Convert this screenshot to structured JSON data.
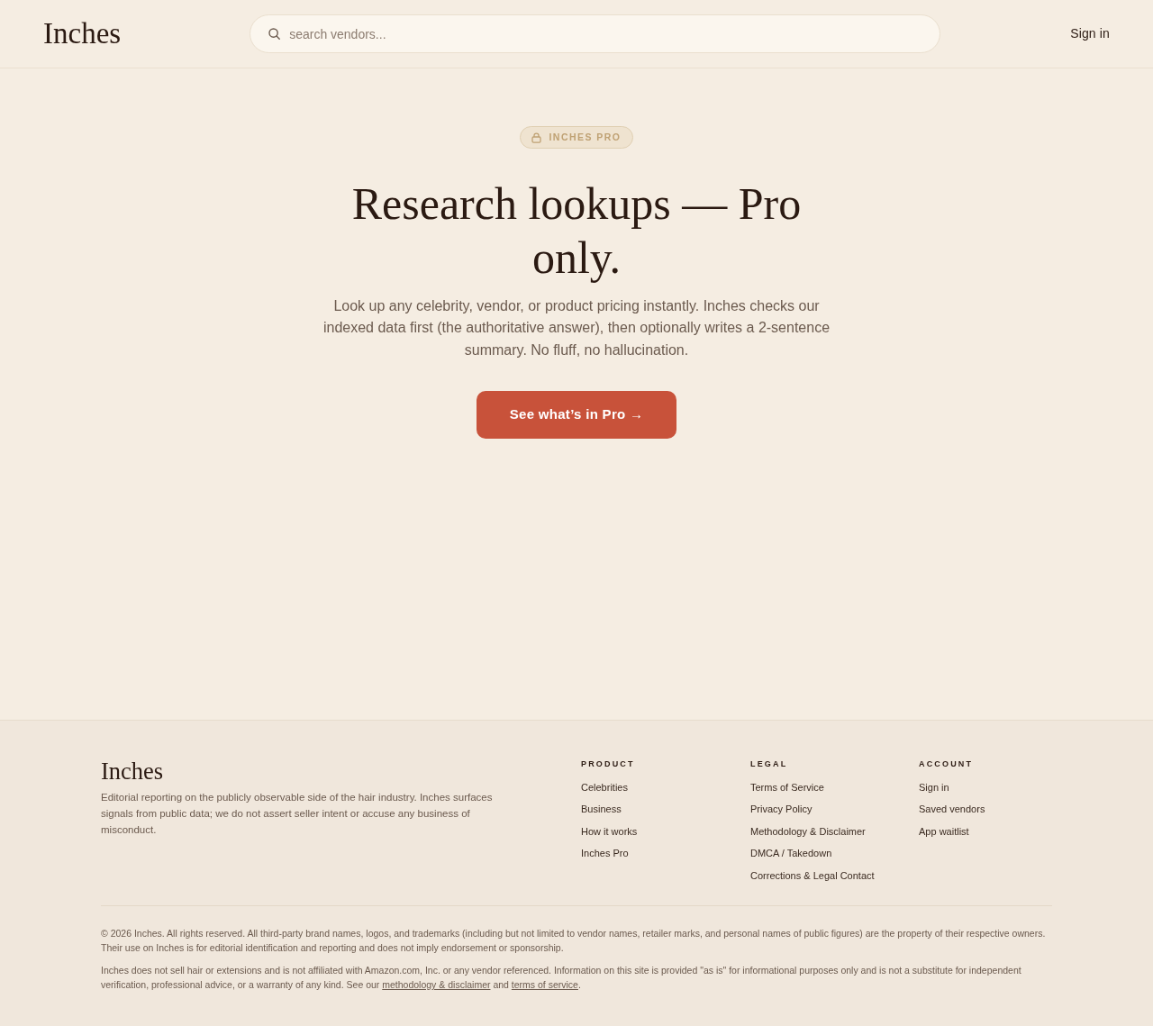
{
  "header": {
    "logo": "Inches",
    "search": {
      "placeholder": "search vendors..."
    },
    "sign_in": "Sign in"
  },
  "hero": {
    "badge": "INCHES PRO",
    "title": "Research lookups — Pro only.",
    "description": "Look up any celebrity, vendor, or product pricing instantly. Inches checks our indexed data first (the authoritative answer), then optionally writes a 2-sentence summary. No fluff, no hallucination.",
    "button": "See what’s in Pro →"
  },
  "footer": {
    "logo": "Inches",
    "tagline": "Editorial reporting on the publicly observable side of the hair industry. Inches surfaces signals from public data; we do not assert seller intent or accuse any business of misconduct.",
    "columns": [
      {
        "heading": "PRODUCT",
        "links": [
          "Celebrities",
          "Business",
          "How it works",
          "Inches Pro"
        ]
      },
      {
        "heading": "LEGAL",
        "links": [
          "Terms of Service",
          "Privacy Policy",
          "Methodology & Disclaimer",
          "DMCA / Takedown",
          "Corrections & Legal Contact"
        ]
      },
      {
        "heading": "ACCOUNT",
        "links": [
          "Sign in",
          "Saved vendors",
          "App waitlist"
        ]
      }
    ],
    "copyright": "© 2026 Inches. All rights reserved. All third-party brand names, logos, and trademarks (including but not limited to vendor names, retailer marks, and personal names of public figures) are the property of their respective owners. Their use on Inches is for editorial identification and reporting and does not imply endorsement or sponsorship.",
    "disclaimer": [
      {
        "kind": "text",
        "text": "Inches does not sell hair or extensions and is not affiliated with Amazon.com, Inc. or any vendor referenced. Information on this site is provided \"as is\" for informational purposes only and is not a substitute for independent verification, professional advice, or a warranty of any kind. See our "
      },
      {
        "kind": "link",
        "text": "methodology & disclaimer"
      },
      {
        "kind": "text",
        "text": " and "
      },
      {
        "kind": "link",
        "text": "terms of service"
      },
      {
        "kind": "text",
        "text": "."
      }
    ]
  }
}
